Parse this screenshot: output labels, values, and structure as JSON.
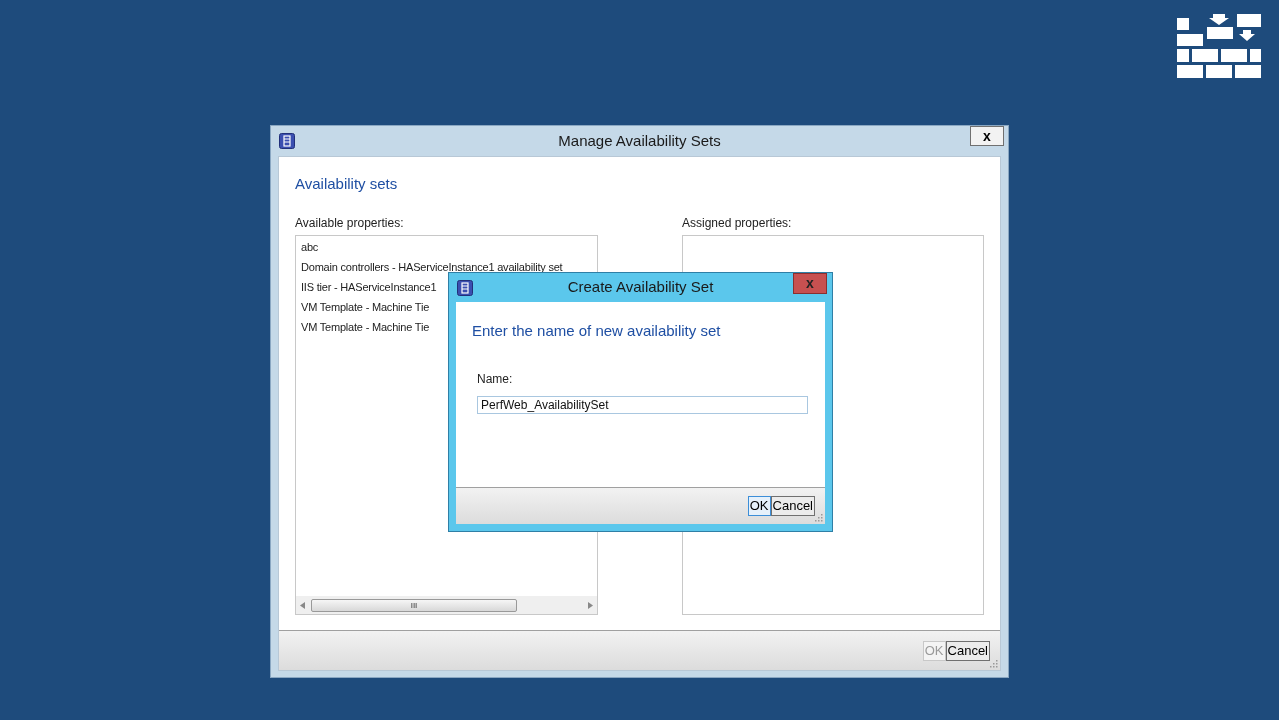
{
  "window": {
    "title": "Manage Availability Sets",
    "close": "x",
    "heading": "Availability sets",
    "available_label": "Available properties:",
    "available_items": [
      "abc",
      "Domain controllers - HAServiceInstance1 availability set",
      "IIS tier - HAServiceInstance1",
      "VM Template - Machine Tie",
      "VM Template - Machine Tie"
    ],
    "scroll_thumb": "III",
    "assigned_label": "Assigned properties:",
    "buttons": [
      {
        "label": "OK",
        "disabled": true,
        "focused": false
      },
      {
        "label": "Cancel",
        "disabled": false,
        "focused": false
      }
    ]
  },
  "dialog": {
    "title": "Create Availability Set",
    "close": "x",
    "heading": "Enter the name of new availability set",
    "name_label": "Name:",
    "name_value": "PerfWeb_AvailabilitySet",
    "buttons": [
      {
        "label": "OK",
        "disabled": false,
        "focused": true
      },
      {
        "label": "Cancel",
        "disabled": false,
        "focused": false
      }
    ]
  }
}
